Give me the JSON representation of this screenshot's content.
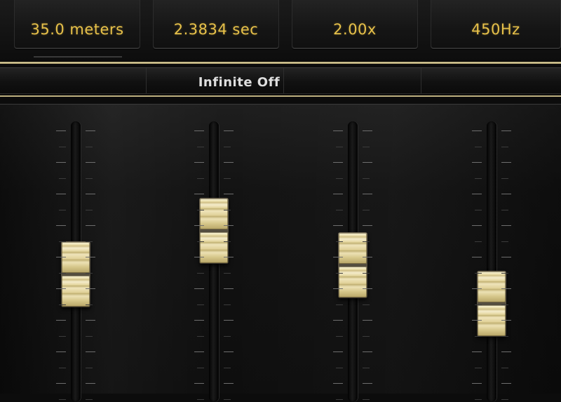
{
  "readouts": [
    {
      "name": "distance",
      "value": "35.0 meters"
    },
    {
      "name": "time",
      "value": "2.3834 sec"
    },
    {
      "name": "ratio",
      "value": "2.00x"
    },
    {
      "name": "frequency",
      "value": "450Hz"
    }
  ],
  "infinite_toggle": {
    "label": "Infinite Off"
  },
  "faders": [
    {
      "name": "fader-1",
      "level": 0.41
    },
    {
      "name": "fader-2",
      "level": 0.61
    },
    {
      "name": "fader-3",
      "level": 0.45
    },
    {
      "name": "fader-4",
      "level": 0.27
    }
  ],
  "colors": {
    "readout_text": "#e7c14a",
    "rail_gold": "#f1e6b8",
    "knob_cream": "#efe4bb"
  }
}
